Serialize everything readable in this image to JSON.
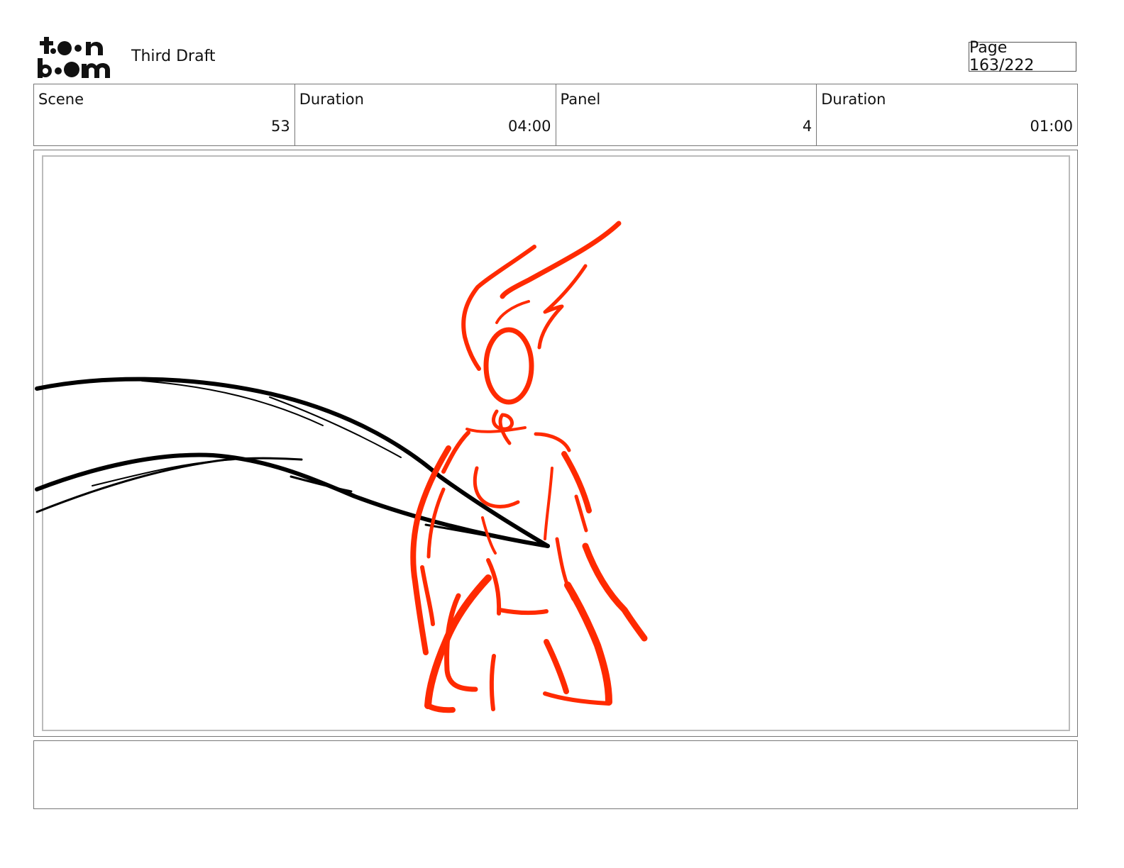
{
  "header": {
    "logo_text": "toon boom",
    "title": "Third Draft",
    "page_label": "Page 163/222"
  },
  "info": {
    "scene": {
      "label": "Scene",
      "value": "53"
    },
    "scene_duration": {
      "label": "Duration",
      "value": "04:00"
    },
    "panel": {
      "label": "Panel",
      "value": "4"
    },
    "panel_duration": {
      "label": "Duration",
      "value": "01:00"
    }
  },
  "colors": {
    "sketch_red": "#ff2a00",
    "sketch_black": "#000000",
    "border": "#777777"
  },
  "notes": {
    "text": ""
  }
}
